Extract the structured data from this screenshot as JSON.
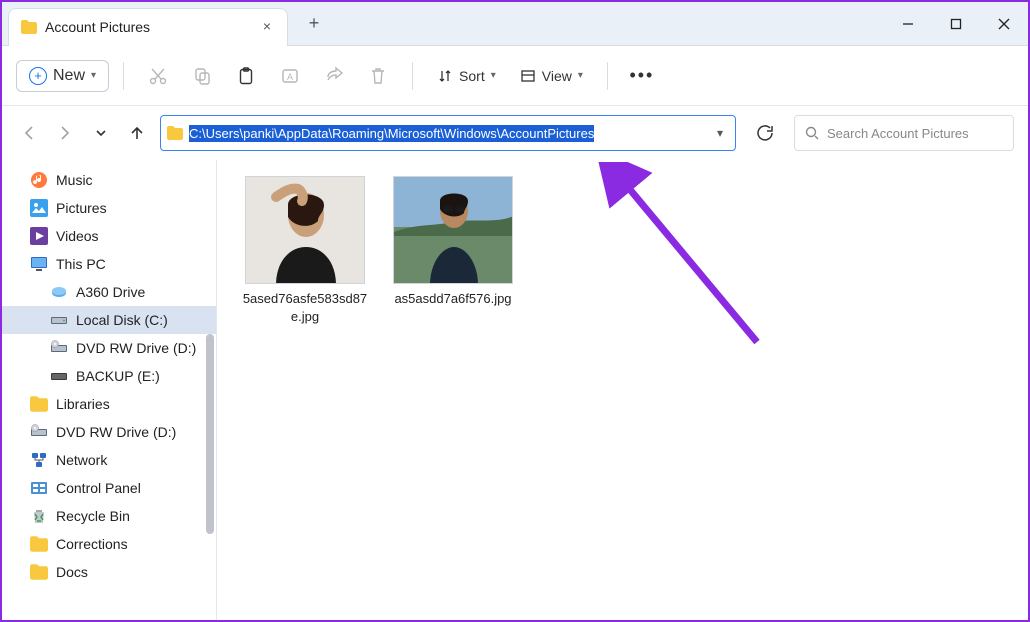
{
  "window": {
    "tab_title": "Account Pictures",
    "address_path": "C:\\Users\\panki\\AppData\\Roaming\\Microsoft\\Windows\\AccountPictures",
    "search_placeholder": "Search Account Pictures"
  },
  "toolbar": {
    "new_label": "New",
    "sort_label": "Sort",
    "view_label": "View"
  },
  "sidebar": {
    "items": [
      {
        "label": "Music",
        "icon": "music",
        "indent": false,
        "selected": false
      },
      {
        "label": "Pictures",
        "icon": "pictures",
        "indent": false,
        "selected": false
      },
      {
        "label": "Videos",
        "icon": "videos",
        "indent": false,
        "selected": false
      },
      {
        "label": "This PC",
        "icon": "thispc",
        "indent": false,
        "selected": false
      },
      {
        "label": "A360 Drive",
        "icon": "a360",
        "indent": true,
        "selected": false
      },
      {
        "label": "Local Disk (C:)",
        "icon": "localdisk",
        "indent": true,
        "selected": true
      },
      {
        "label": "DVD RW Drive (D:)",
        "icon": "dvd",
        "indent": true,
        "selected": false
      },
      {
        "label": "BACKUP (E:)",
        "icon": "backup",
        "indent": true,
        "selected": false
      },
      {
        "label": "Libraries",
        "icon": "folder",
        "indent": false,
        "selected": false
      },
      {
        "label": "DVD RW Drive (D:)",
        "icon": "dvd",
        "indent": false,
        "selected": false
      },
      {
        "label": "Network",
        "icon": "network",
        "indent": false,
        "selected": false
      },
      {
        "label": "Control Panel",
        "icon": "controlpanel",
        "indent": false,
        "selected": false
      },
      {
        "label": "Recycle Bin",
        "icon": "recycle",
        "indent": false,
        "selected": false
      },
      {
        "label": "Corrections",
        "icon": "folder",
        "indent": false,
        "selected": false
      },
      {
        "label": "Docs",
        "icon": "folder",
        "indent": false,
        "selected": false
      }
    ]
  },
  "files": [
    {
      "name": "5ased76asfe583sd87e.jpg",
      "thumb": "person1"
    },
    {
      "name": "as5asdd7a6f576.jpg",
      "thumb": "person2"
    }
  ],
  "colors": {
    "accent": "#1a73e8",
    "path_highlight": "#1a5fd6",
    "annotation": "#8a2be2"
  }
}
